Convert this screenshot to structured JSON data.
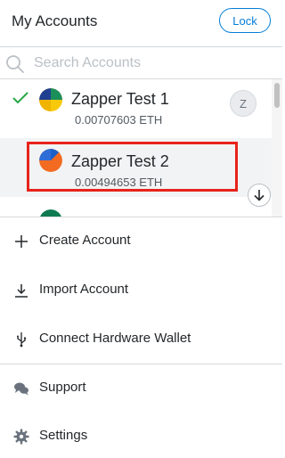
{
  "header": {
    "title": "My Accounts",
    "lock_label": "Lock"
  },
  "search": {
    "placeholder": "Search Accounts"
  },
  "accounts": [
    {
      "name": "Zapper Test 1",
      "balance": "0.00707603 ETH",
      "selected": true,
      "keyring_badge": "Z"
    },
    {
      "name": "Zapper Test 2",
      "balance": "0.00494653 ETH",
      "selected": false,
      "highlighted": true
    },
    {
      "name": "",
      "balance": ""
    }
  ],
  "menu": {
    "create_account": "Create Account",
    "import_account": "Import Account",
    "connect_hardware": "Connect Hardware Wallet",
    "support": "Support",
    "settings": "Settings"
  },
  "colors": {
    "accent": "#037dd6",
    "check": "#28a745",
    "highlight_box": "#e8231b",
    "text_primary": "#24272a",
    "placeholder": "#bbc0c5"
  },
  "icons": {
    "search": "search-icon",
    "check": "check-icon",
    "scroll_down": "arrow-down-icon",
    "create": "plus-icon",
    "import": "download-icon",
    "hardware": "usb-icon",
    "support": "chat-bubbles-icon",
    "settings": "gear-icon"
  }
}
